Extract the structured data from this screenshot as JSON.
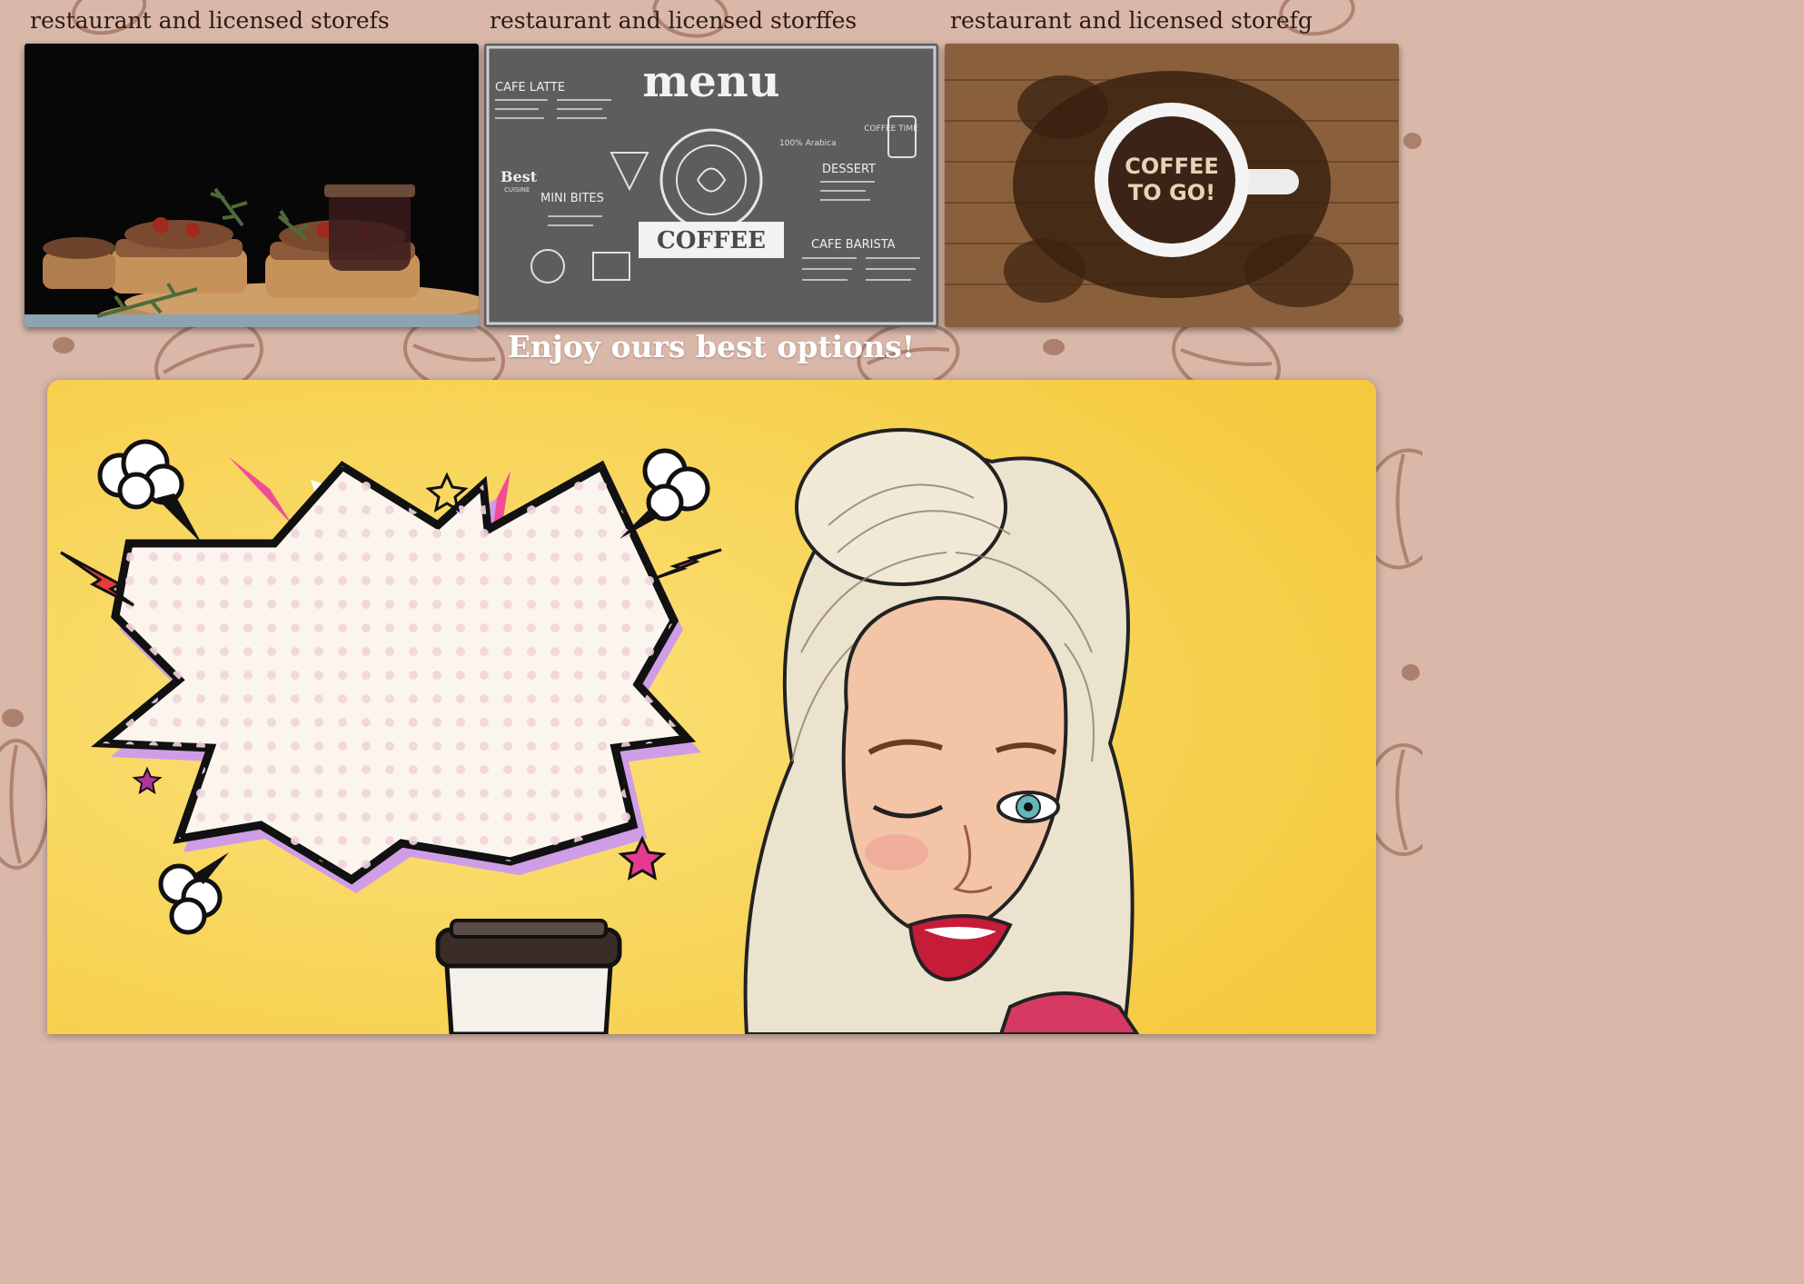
{
  "stores": [
    {
      "title": "restaurant and licensed storefs",
      "image": "bruschetta-photo"
    },
    {
      "title": "restaurant and licensed storffes",
      "image": "chalkboard-menu-photo"
    },
    {
      "title": "restaurant and licensed storefg",
      "image": "coffee-to-go-photo"
    }
  ],
  "menu_board": {
    "heading": "menu",
    "sections": [
      "CAFE LATTE",
      "MINI BITES",
      "DESSERT",
      "CAFE BARISTA"
    ],
    "badge": "COFFEE",
    "corner": "COFFEE TIME",
    "best": "Best",
    "cuisine": "CUISINE",
    "arabica": "100% Arabica"
  },
  "coffee_cup": {
    "line1": "COFFEE",
    "line2": "TO GO!"
  },
  "tagline": "Enjoy ours best options!",
  "banner": {
    "image": "pop-art-woman-coffee"
  },
  "colors": {
    "page_background": "#d9b8aa",
    "pattern": "#a77a66",
    "banner_yellow": "#f6cc45",
    "speech_bubble": "#fbf5ee",
    "bubble_shadow": "#cf9de6",
    "title_text": "#2c1a14",
    "tagline_text": "#ffffff"
  }
}
